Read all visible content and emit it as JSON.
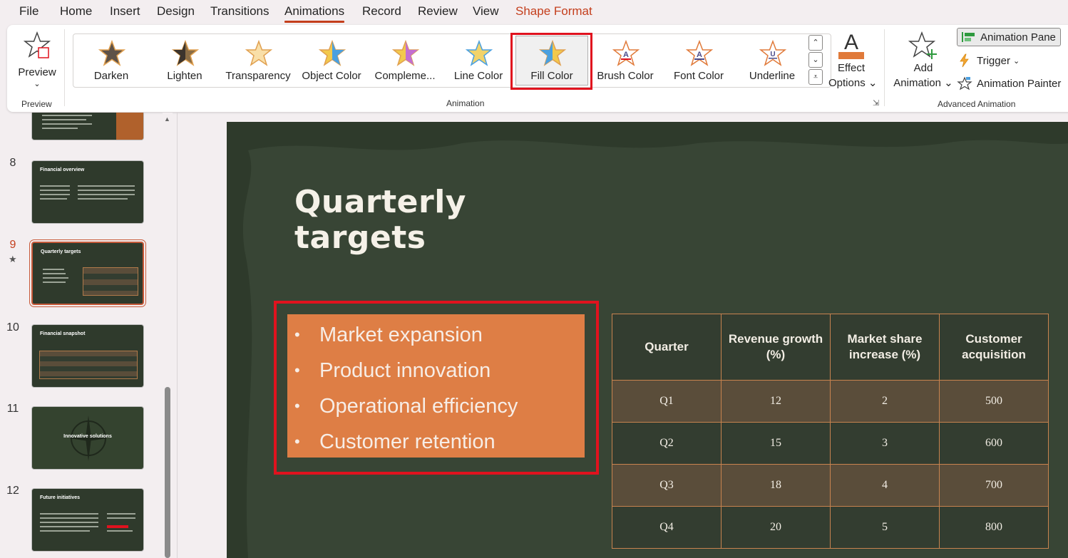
{
  "menu": {
    "tabs": [
      "File",
      "Home",
      "Insert",
      "Design",
      "Transitions",
      "Animations",
      "Record",
      "Review",
      "View",
      "Shape Format"
    ],
    "active_tab": "Animations",
    "contextual_tab": "Shape Format"
  },
  "ribbon": {
    "preview_group": {
      "button_label": "Preview",
      "group_label": "Preview"
    },
    "animation_group": {
      "group_label": "Animation",
      "effects": [
        {
          "label": "Darken",
          "color": "#6b5a48"
        },
        {
          "label": "Lighten",
          "color": "#9a7a52"
        },
        {
          "label": "Transparency",
          "color": "#f5cf8a"
        },
        {
          "label": "Object Color",
          "color": "#4aa0e0"
        },
        {
          "label": "Compleme...",
          "color": "#c36fd1"
        },
        {
          "label": "Line Color",
          "color": "#f2c94c"
        },
        {
          "label": "Fill Color",
          "color": "#4aa0e0"
        },
        {
          "label": "Brush Color",
          "color": "#ffffff"
        },
        {
          "label": "Font Color",
          "color": "#ffffff"
        },
        {
          "label": "Underline",
          "color": "#ffffff"
        }
      ],
      "selected_effect": "Fill Color",
      "effect_options_line1": "Effect",
      "effect_options_line2": "Options"
    },
    "advanced_group": {
      "group_label": "Advanced Animation",
      "add_animation_line1": "Add",
      "add_animation_line2": "Animation",
      "animation_pane": "Animation Pane",
      "trigger": "Trigger",
      "animation_painter": "Animation Painter"
    }
  },
  "slides_panel": {
    "items": [
      {
        "number": "8",
        "title": "Financial overview"
      },
      {
        "number": "9",
        "title": "Quarterly targets"
      },
      {
        "number": "10",
        "title": "Financial snapshot"
      },
      {
        "number": "11",
        "title": "Innovative solutions"
      },
      {
        "number": "12",
        "title": "Future initiatives"
      }
    ],
    "selected": "9",
    "star_icon": "animation-star-icon"
  },
  "slide": {
    "title": "Quarterly targets",
    "bullets": [
      "Market expansion",
      "Product innovation",
      "Operational efficiency",
      "Customer retention"
    ],
    "table": {
      "headers": [
        "Quarter",
        "Revenue growth (%)",
        "Market share increase (%)",
        "Customer acquisition"
      ],
      "rows": [
        [
          "Q1",
          "12",
          "2",
          "500"
        ],
        [
          "Q2",
          "15",
          "3",
          "600"
        ],
        [
          "Q3",
          "18",
          "4",
          "700"
        ],
        [
          "Q4",
          "20",
          "5",
          "800"
        ]
      ]
    }
  },
  "colors": {
    "accent": "#c43e1c",
    "highlight": "#e0121e",
    "slide_bg": "#2e3a2b",
    "bullet_fill": "#de7e45",
    "table_border": "#c8834f"
  }
}
